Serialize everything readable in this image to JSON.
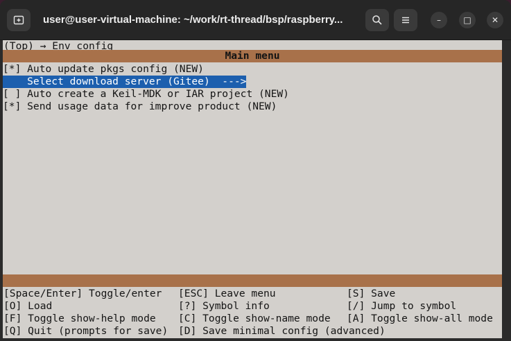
{
  "window": {
    "title": "user@user-virtual-machine: ~/work/rt-thread/bsp/raspberry...",
    "minimize_glyph": "–",
    "maximize_glyph": "□",
    "close_glyph": "✕"
  },
  "terminal": {
    "breadcrumb": "(Top) → Env config",
    "menu_title": "Main menu",
    "items": [
      {
        "label": "[*] Auto update pkgs config (NEW)"
      },
      {
        "label": "    Select download server (Gitee)  --->",
        "selected": true
      },
      {
        "label": "[ ] Auto create a Keil-MDK or IAR project (NEW)"
      },
      {
        "label": "[*] Send usage data for improve product (NEW)"
      }
    ],
    "help": {
      "row0": [
        "[Space/Enter] Toggle/enter",
        "[ESC] Leave menu",
        "[S] Save"
      ],
      "row1": [
        "[O] Load",
        "[?] Symbol info",
        "[/] Jump to symbol"
      ],
      "row2": [
        "[F] Toggle show-help mode",
        "[C] Toggle show-name mode",
        "[A] Toggle show-all mode"
      ],
      "row3": [
        "[Q] Quit (prompts for save)",
        "[D] Save minimal config (advanced)",
        ""
      ]
    }
  },
  "colors": {
    "terminal_bg": "#d3d0cc",
    "menu_bar": "#a8714a",
    "selection": "#1c5fae",
    "titlebar": "#262626"
  },
  "icons": [
    "new-tab-icon",
    "search-icon",
    "hamburger-menu-icon",
    "minimize-icon",
    "maximize-icon",
    "close-icon"
  ]
}
